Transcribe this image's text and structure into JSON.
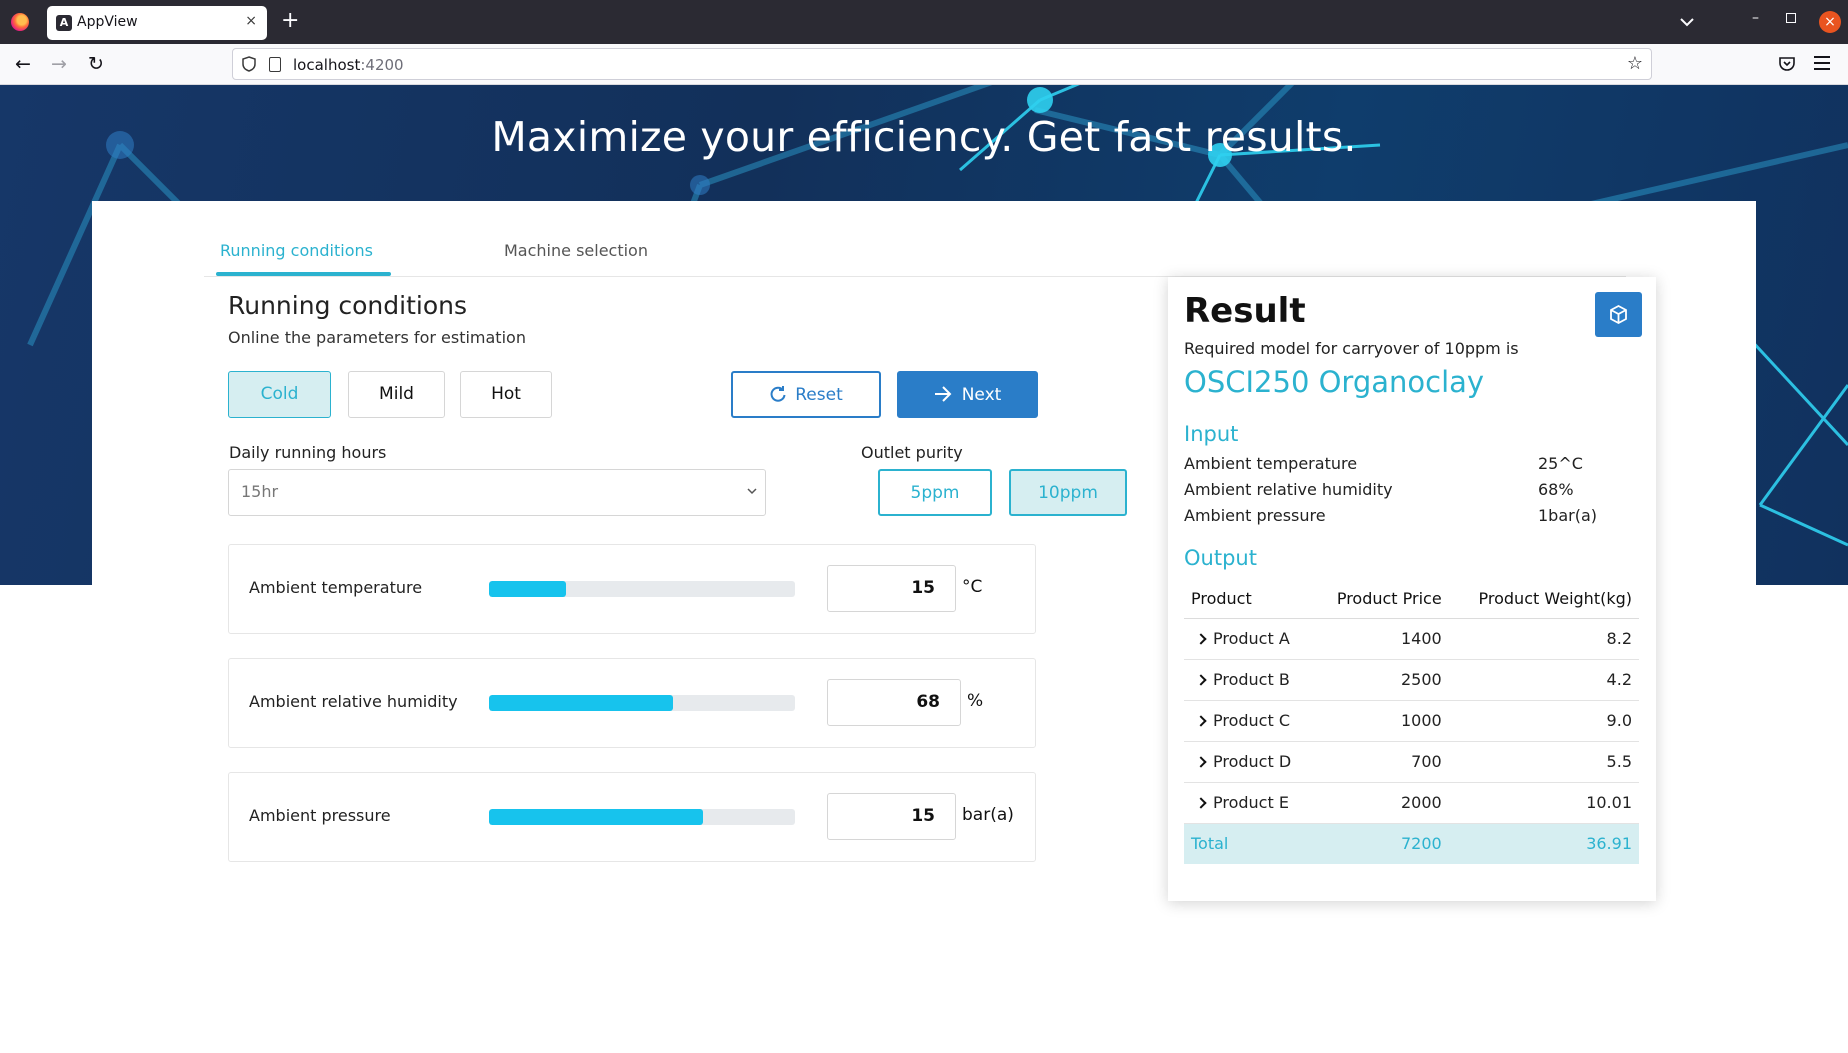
{
  "browser": {
    "tab_title": "AppView",
    "tab_close": "×",
    "new_tab": "+",
    "url_host": "localhost",
    "url_port": ":4200",
    "back": "←",
    "forward": "→",
    "reload": "↻",
    "bookmark": "☆",
    "minimize": "–",
    "close": "×"
  },
  "hero": {
    "title": "Maximize your efficiency. Get fast results."
  },
  "tabs": {
    "running": "Running conditions",
    "machine": "Machine selection"
  },
  "form": {
    "title": "Running conditions",
    "subtitle": "Online the parameters for estimation",
    "climate_options": [
      "Cold",
      "Mild",
      "Hot"
    ],
    "climate_selected": "Cold",
    "reset_label": "Reset",
    "next_label": "Next",
    "hours_label": "Daily running hours",
    "hours_value": "15hr",
    "purity_label": "Outlet purity",
    "purity_options": [
      "5ppm",
      "10ppm"
    ],
    "purity_selected": "10ppm",
    "params": [
      {
        "label": "Ambient temperature",
        "value": "15",
        "unit": "°C",
        "fill": 0.25
      },
      {
        "label": "Ambient relative humidity",
        "value": "68",
        "unit": "%",
        "fill": 0.6
      },
      {
        "label": "Ambient pressure",
        "value": "15",
        "unit": "bar(a)",
        "fill": 0.7
      }
    ]
  },
  "result": {
    "title": "Result",
    "subtitle": "Required model for carryover of 10ppm is",
    "model": "OSCI250 Organoclay",
    "input_heading": "Input",
    "inputs": [
      {
        "label": "Ambient temperature",
        "value": "25^C"
      },
      {
        "label": "Ambient relative humidity",
        "value": "68%"
      },
      {
        "label": "Ambient pressure",
        "value": "1bar(a)"
      }
    ],
    "output_heading": "Output",
    "columns": [
      "Product",
      "Product Price",
      "Product Weight(kg)"
    ],
    "rows": [
      {
        "product": "Product A",
        "price": "1400",
        "weight": "8.2"
      },
      {
        "product": "Product B",
        "price": "2500",
        "weight": "4.2"
      },
      {
        "product": "Product C",
        "price": "1000",
        "weight": "9.0"
      },
      {
        "product": "Product D",
        "price": "700",
        "weight": "5.5"
      },
      {
        "product": "Product E",
        "price": "2000",
        "weight": "10.01"
      }
    ],
    "total": {
      "label": "Total",
      "price": "7200",
      "weight": "36.91"
    }
  },
  "colors": {
    "accent": "#2bb2cf",
    "primary": "#2a7dc8",
    "slider": "#17c3ed",
    "hero_bg": "#12305a"
  }
}
